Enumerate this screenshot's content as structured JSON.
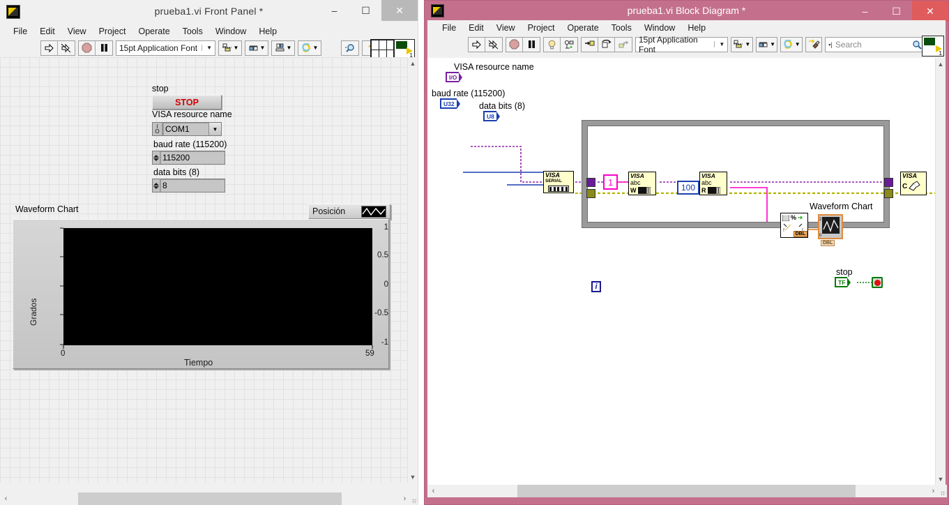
{
  "front_panel": {
    "title": "prueba1.vi Front Panel *",
    "app_icon_name": "labview-vi-icon",
    "window_buttons": {
      "minimize": "–",
      "maximize": "☐",
      "close": "✕"
    },
    "menu": [
      "File",
      "Edit",
      "View",
      "Project",
      "Operate",
      "Tools",
      "Window",
      "Help"
    ],
    "toolbar": {
      "run_label": "⇨",
      "run_continuous_label": "↻",
      "abort_label": "",
      "pause_label": "❘❘",
      "font": "15pt Application Font",
      "font_caret": "▼",
      "align_caret": "▼",
      "distribute_caret": "▼",
      "resize_caret": "▼",
      "reorder_caret": "▼",
      "search_label": "",
      "help_label": "?",
      "conn_number": "1"
    },
    "controls": {
      "stop_label": "stop",
      "stop_button": "STOP",
      "visa_label": "VISA resource name",
      "visa_value": "COM1",
      "visa_badge_top": "I",
      "visa_badge_bottom": "O",
      "visa_caret": "▼",
      "baud_label": "baud rate (115200)",
      "baud_value": "115200",
      "databits_label": "data bits (8)",
      "databits_value": "8"
    },
    "chart": {
      "title": "Waveform Chart",
      "legend_plot_name": "Posición",
      "plot_icon": "waveform-icon"
    },
    "scroll": {
      "left_arrow": "‹",
      "right_arrow": "›",
      "up_arrow": "▲",
      "down_arrow": "▼"
    }
  },
  "chart_data": {
    "type": "line",
    "title": "Waveform Chart",
    "xlabel": "Tiempo",
    "ylabel": "Grados",
    "xlim": [
      0,
      59
    ],
    "ylim": [
      -1,
      1
    ],
    "xticks": [
      "0",
      "59"
    ],
    "yticks": [
      "1",
      "0.5",
      "0",
      "-0.5",
      "-1"
    ],
    "grid": false,
    "legend_position": "top-right",
    "plot_background": "#000000",
    "series": [
      {
        "name": "Posición",
        "color": "#ffffff",
        "x": [],
        "values": []
      }
    ]
  },
  "block_diagram": {
    "title": "prueba1.vi Block Diagram *",
    "app_icon_name": "labview-vi-icon",
    "window_buttons": {
      "minimize": "–",
      "maximize": "☐",
      "close": "✕"
    },
    "titlebar_color": "#c4708c",
    "menu": [
      "File",
      "Edit",
      "View",
      "Project",
      "Operate",
      "Tools",
      "Window",
      "Help"
    ],
    "toolbar": {
      "run_label": "⇨",
      "run_continuous_label": "↻",
      "abort_label": "",
      "pause_label": "❘❘",
      "highlight_label": "",
      "retain_wire_label": "",
      "step_into_label": "",
      "step_over_label": "",
      "step_out_label": "",
      "font": "15pt Application Font",
      "font_caret": "▼",
      "align_caret": "▼",
      "distribute_caret": "▼",
      "reorder_caret": "▼",
      "cleanup_label": "",
      "search_placeholder": "Search",
      "help_label": "?",
      "conn_number": "1"
    },
    "labels": {
      "visa_resource": "VISA resource name",
      "baud_rate": "baud rate (115200)",
      "data_bits": "data bits (8)",
      "waveform_chart": "Waveform Chart",
      "stop": "stop"
    },
    "terminals": {
      "visa_io": "I/O",
      "baud_u32": "U32",
      "databits_u8": "U8",
      "stop_tf": "TF",
      "chart_dbl": "DBL",
      "scan_dbl": "DBL"
    },
    "constants": {
      "write_string": "1",
      "read_count": "100"
    },
    "nodes": [
      {
        "name": "visa-configure-serial-port",
        "top": "VISA",
        "mid": "SERIAL"
      },
      {
        "name": "visa-write",
        "top": "VISA",
        "mid": "abc",
        "bottom": "W"
      },
      {
        "name": "visa-read",
        "top": "VISA",
        "mid": "abc",
        "bottom": "R"
      },
      {
        "name": "visa-close",
        "top": "VISA",
        "mid": "C"
      },
      {
        "name": "scan-from-string",
        "top": "%",
        "badge": "DBL"
      },
      {
        "name": "waveform-chart-terminal",
        "badge": "DBL"
      }
    ],
    "iteration_terminal": "i",
    "colors": {
      "visa_wire": "#8e24aa",
      "error_wire": "#b3b300",
      "number_wire": "#1a3fb0",
      "string_wire": "#ff00c8",
      "dbl_wire": "#e08a3c",
      "bool_wire": "#0a7a0a",
      "loop_border": "#9a9a9a"
    },
    "scroll": {
      "left_arrow": "‹",
      "right_arrow": "›",
      "up_arrow": "▲",
      "down_arrow": "▼"
    }
  }
}
